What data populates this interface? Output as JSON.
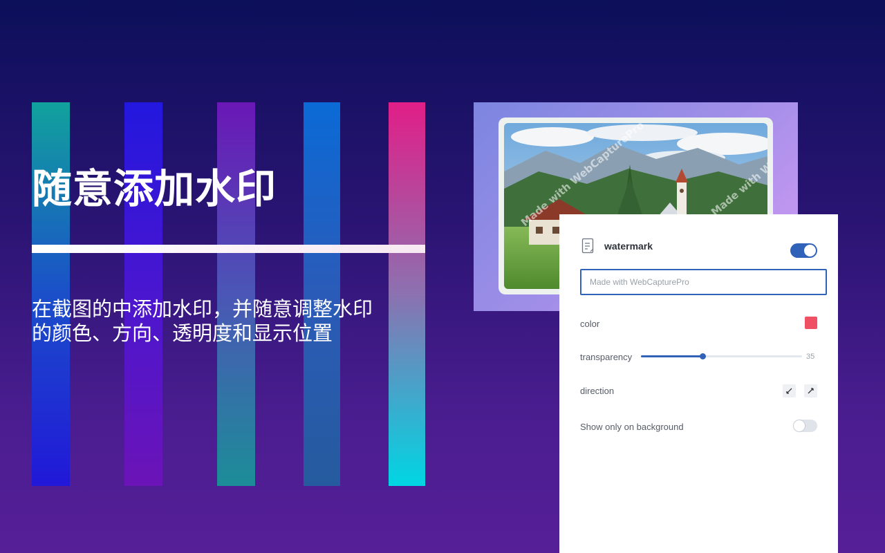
{
  "hero": {
    "title": "随意添加水印",
    "description_line1": "在截图的中添加水印，并随意调整水印",
    "description_line2": "的颜色、方向、透明度和显示位置"
  },
  "preview": {
    "watermark_text": "Made with WebCapturePro"
  },
  "panel": {
    "icon": "document-icon",
    "title": "watermark",
    "enabled": true,
    "input": {
      "value": "",
      "placeholder": "Made with WebCapturePro"
    },
    "color": {
      "label": "color",
      "value": "#f05063"
    },
    "transparency": {
      "label": "transparency",
      "value": "35",
      "fill_fraction": 0.38
    },
    "direction": {
      "label": "direction",
      "options": [
        "diagonal-down-icon",
        "diagonal-up-icon"
      ]
    },
    "background_only": {
      "label": "Show only on background",
      "enabled": false
    }
  },
  "colors": {
    "accent": "#2f62b8",
    "swatch": "#f05063"
  }
}
